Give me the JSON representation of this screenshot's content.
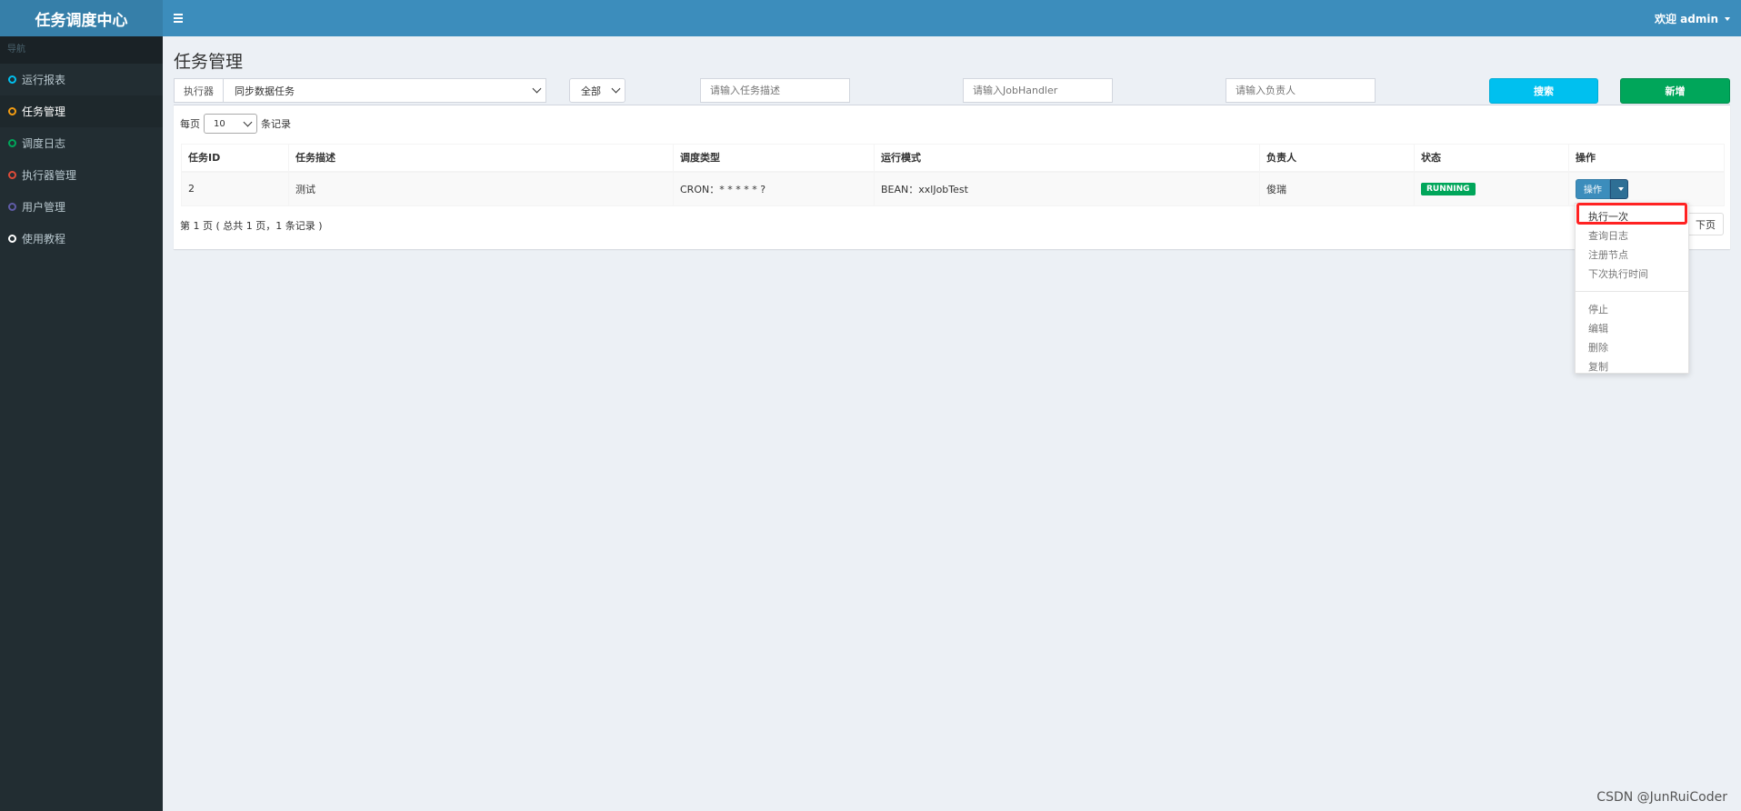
{
  "app": {
    "title": "任务调度中心"
  },
  "header": {
    "welcome": "欢迎 admin"
  },
  "sidebar": {
    "header": "导航",
    "items": [
      {
        "label": "运行报表",
        "color": "#00c0ef"
      },
      {
        "label": "任务管理",
        "color": "#f39c12"
      },
      {
        "label": "调度日志",
        "color": "#00a65a"
      },
      {
        "label": "执行器管理",
        "color": "#dd4b39"
      },
      {
        "label": "用户管理",
        "color": "#605ca8"
      },
      {
        "label": "使用教程",
        "color": "#ffffff"
      }
    ]
  },
  "page": {
    "title": "任务管理"
  },
  "filters": {
    "executor_label": "执行器",
    "executor_value": "同步数据任务",
    "status_value": "全部",
    "desc_placeholder": "请输入任务描述",
    "handler_placeholder": "请输入JobHandler",
    "author_placeholder": "请输入负责人",
    "search_label": "搜索",
    "add_label": "新增"
  },
  "table": {
    "length_prefix": "每页",
    "length_value": "10",
    "length_suffix": "条记录",
    "headers": [
      "任务ID",
      "任务描述",
      "调度类型",
      "运行模式",
      "负责人",
      "状态",
      "操作"
    ],
    "rows": [
      {
        "id": "2",
        "desc": "测试",
        "schedule": "CRON：* * * * * ?",
        "mode": "BEAN：xxlJobTest",
        "author": "俊瑞",
        "status": "RUNNING",
        "action": "操作"
      }
    ],
    "page_info": "第 1 页 ( 总共 1 页，1 条记录 )",
    "next_label": "下页"
  },
  "dropdown": {
    "group1": [
      "执行一次",
      "查询日志",
      "注册节点",
      "下次执行时间"
    ],
    "group2": [
      "停止",
      "编辑",
      "删除",
      "复制"
    ]
  },
  "watermark": "CSDN @JunRuiCoder"
}
